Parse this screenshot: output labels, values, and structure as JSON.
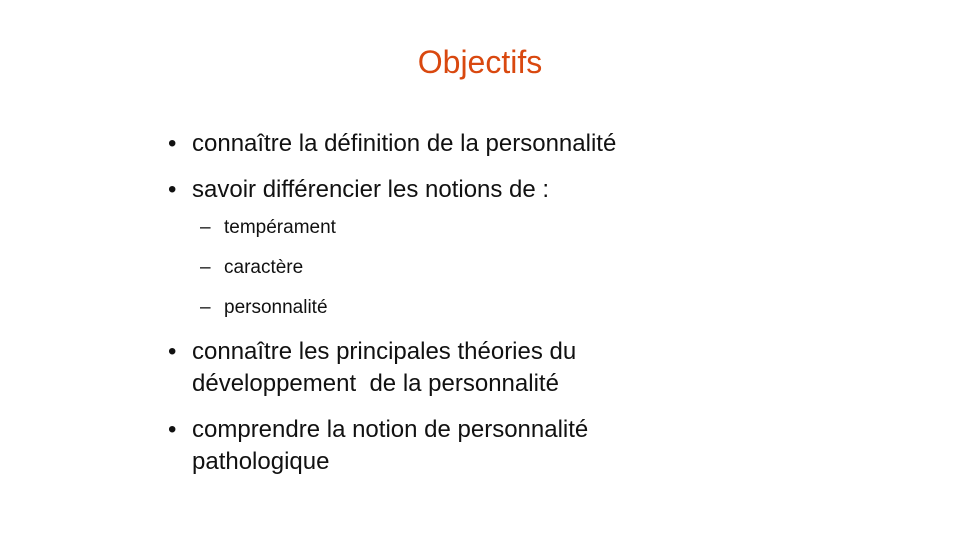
{
  "slide": {
    "title": "Objectifs",
    "bullets": [
      {
        "text": "connaître la définition de la personnalité"
      },
      {
        "text": "savoir différencier les notions de :",
        "subitems": [
          "tempérament",
          "caractère",
          "personnalité"
        ]
      },
      {
        "line1": "connaître les principales théories du",
        "line2": "développement  de la personnalité"
      },
      {
        "line1": "comprendre la notion de personnalité",
        "line2": "pathologique"
      }
    ],
    "bullet_glyph": "•",
    "sub_glyph": "–",
    "colors": {
      "title": "#d9480f",
      "text": "#111111",
      "background": "#ffffff"
    }
  }
}
